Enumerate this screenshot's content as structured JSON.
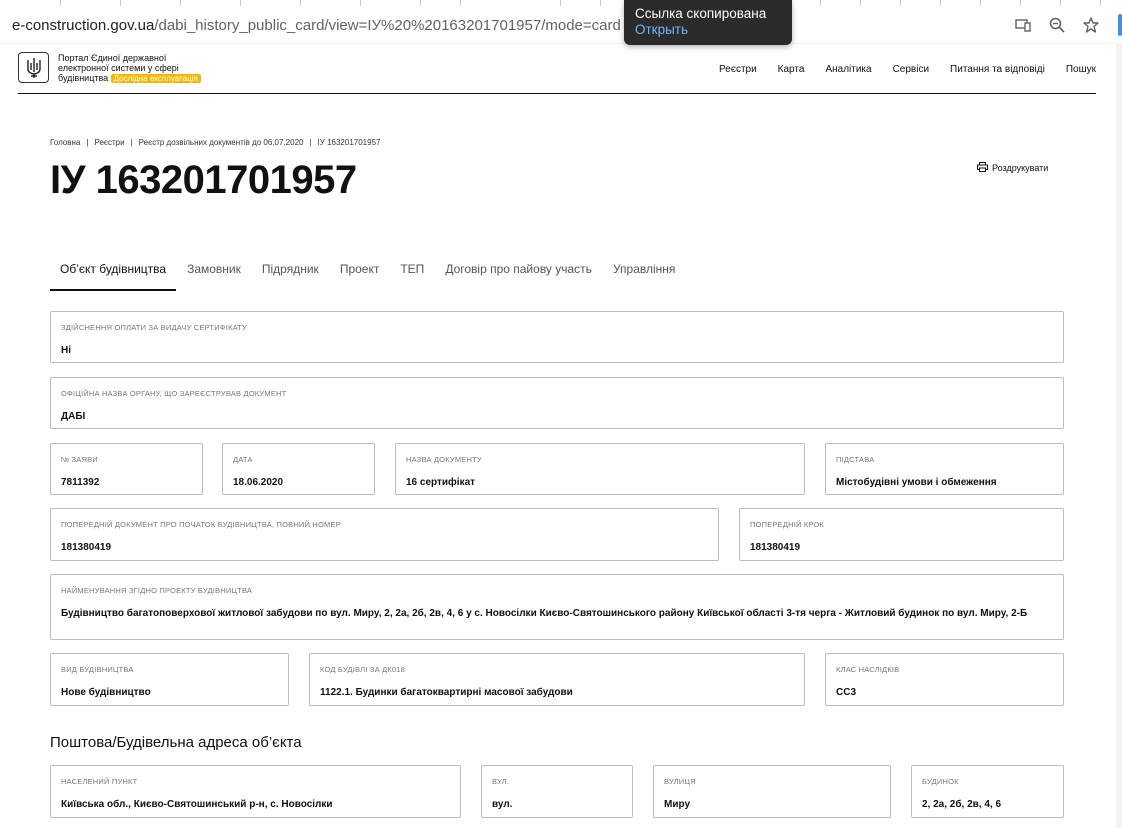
{
  "browser": {
    "url_host": "e-construction.gov.ua",
    "url_path": "/dabi_history_public_card/view=ІУ%20%20163201701957/mode=card",
    "icons": [
      "cast-icon",
      "zoom-icon",
      "star-icon"
    ]
  },
  "toast": {
    "message": "Ссылка скопирована",
    "action": "Открыть"
  },
  "header": {
    "portal_line1": "Портал Єдиної державної",
    "portal_line2": "електронної системи у сфері",
    "portal_line3": "будівництва",
    "badge": "Дослідна експлуатація",
    "nav": [
      "Реєстри",
      "Карта",
      "Аналітика",
      "Сервіси",
      "Питання та відповіді",
      "Пошук"
    ]
  },
  "breadcrumb": [
    "Головна",
    "Реєстри",
    "Реєстр дозвільних документів до 06.07.2020",
    "ІУ 163201701957"
  ],
  "title": "ІУ 163201701957",
  "print_label": "Роздрукувати",
  "tabs": [
    "Об’єкт будівництва",
    "Замовник",
    "Підрядник",
    "Проект",
    "ТЕП",
    "Договір про пайову участь",
    "Управління"
  ],
  "fields": {
    "payment": {
      "label": "Здійснення оплати за видачу сертифікату",
      "value": "Ні"
    },
    "authority": {
      "label": "Офіційна назва органу, що зареєстрував документ",
      "value": "ДАБІ"
    },
    "app_no": {
      "label": "№ заяви",
      "value": "7811392"
    },
    "date": {
      "label": "Дата",
      "value": "18.06.2020"
    },
    "doc_name": {
      "label": "Назва документу",
      "value": "16 сертифікат"
    },
    "basis": {
      "label": "Підстава",
      "value": "Містобудівні умови і обмеження"
    },
    "prev_doc": {
      "label": "Попередній документ про початок будівництва, повний номер",
      "value": "181380419"
    },
    "prev_step": {
      "label": "Попередній крок",
      "value": "181380419"
    },
    "project_name": {
      "label": "Найменування згідно проекту будівництва",
      "value": "Будівництво багатоповерхової житлової забудови по вул. Миру, 2, 2а, 2б, 2в, 4, 6 у с. Новосілки Києво-Святошинського району Київської області 3-тя черга - Житловий будинок по вул. Миру, 2-Б"
    },
    "build_type": {
      "label": "Вид будівництва",
      "value": "Нове будівництво"
    },
    "building_code": {
      "label": "Код будівлі за ДК018",
      "value": "1122.1. Будинки багатоквартирні масової забудови"
    },
    "consequence": {
      "label": "Клас наслідків",
      "value": "СС3"
    }
  },
  "address_title": "Поштова/Будівельна адреса об’єкта",
  "address": {
    "settlement": {
      "label": "Населений пункт",
      "value": "Київська обл., Києво-Святошинський р-н, с. Новосілки"
    },
    "street_type": {
      "label": "Вул.",
      "value": "вул."
    },
    "street": {
      "label": "Вулиця",
      "value": "Миру"
    },
    "building": {
      "label": "Будинок",
      "value": "2, 2а, 2б, 2в, 4, 6"
    }
  }
}
